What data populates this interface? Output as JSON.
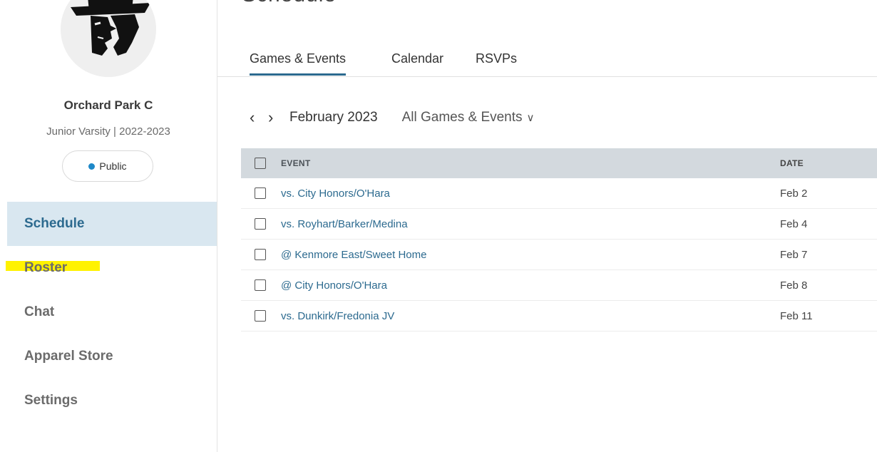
{
  "sidebar": {
    "team_name": "Orchard Park C",
    "team_sub": "Junior Varsity | 2022-2023",
    "visibility": "Public",
    "visibility_dot_color": "#1e88c8",
    "nav": [
      {
        "label": "Schedule",
        "active": true
      },
      {
        "label": "Roster",
        "highlighted": true
      },
      {
        "label": "Chat"
      },
      {
        "label": "Apparel Store"
      },
      {
        "label": "Settings"
      }
    ]
  },
  "main": {
    "title": "Schedule",
    "tabs": [
      {
        "label": "Games & Events",
        "active": true
      },
      {
        "label": "Calendar"
      },
      {
        "label": "RSVPs"
      }
    ],
    "toolbar": {
      "month": "February 2023",
      "filter": "All Games & Events",
      "prev_icon": "chevron-left-icon",
      "next_icon": "chevron-right-icon"
    },
    "table": {
      "headers": {
        "event": "EVENT",
        "date": "DATE"
      },
      "rows": [
        {
          "event": "vs. City Honors/O'Hara",
          "date": "Feb 2"
        },
        {
          "event": "vs. Royhart/Barker/Medina",
          "date": "Feb 4"
        },
        {
          "event": "@ Kenmore East/Sweet Home",
          "date": "Feb 7"
        },
        {
          "event": "@ City Honors/O'Hara",
          "date": "Feb 8"
        },
        {
          "event": "vs. Dunkirk/Fredonia JV",
          "date": "Feb 11"
        }
      ]
    }
  },
  "colors": {
    "accent": "#2c6a8f",
    "active_nav_bg": "#d9e7f0",
    "header_bg": "#d3d9de",
    "highlight": "#fff200"
  }
}
